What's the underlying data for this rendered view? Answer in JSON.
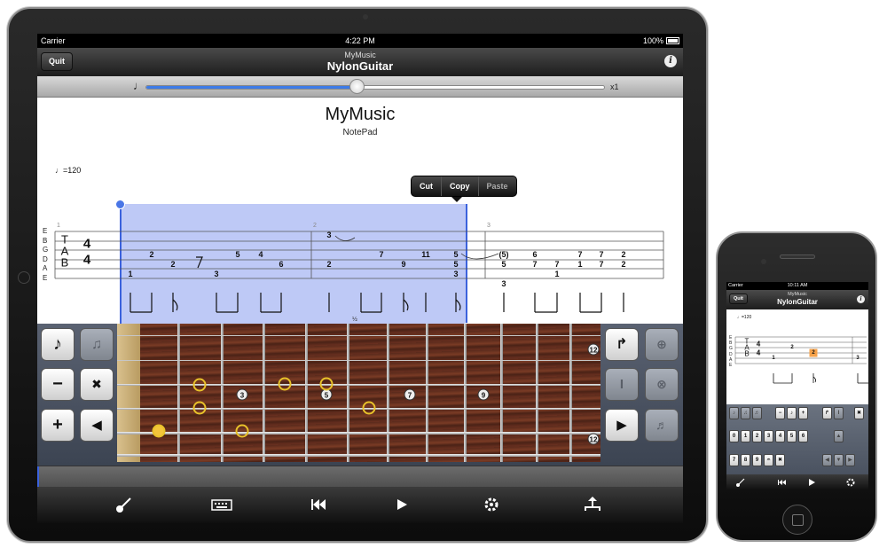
{
  "statusbar": {
    "carrier": "Carrier",
    "time": "4:22 PM",
    "battery": "100%"
  },
  "navbar": {
    "quit": "Quit",
    "subtitle": "MyMusic",
    "title": "NylonGuitar",
    "info": "i"
  },
  "tempo_slider": {
    "note": "♩",
    "multiplier": "x1",
    "value": 0.46
  },
  "score": {
    "title": "MyMusic",
    "subtitle": "NotePad",
    "tempo": "=120",
    "string_names": [
      "E",
      "B",
      "G",
      "D",
      "A",
      "E"
    ],
    "tab_clef": [
      "T",
      "A",
      "B"
    ],
    "time_signature": [
      "4",
      "4"
    ],
    "measure_numbers": [
      "1",
      "2",
      "3"
    ],
    "context_menu": [
      "Cut",
      "Copy",
      "Paste"
    ],
    "measure1": [
      "1",
      "2",
      "2",
      "3",
      "5",
      "4",
      "6"
    ],
    "measure2": [
      "3",
      "2",
      "7",
      "9",
      "11",
      "5",
      "5",
      "3"
    ],
    "measure3": [
      "(5)",
      "5",
      "3",
      "6",
      "7",
      "7",
      "1",
      "7",
      "1",
      "7",
      "7",
      "2",
      "2"
    ]
  },
  "fretboard": {
    "half_marker": "½",
    "markers": [
      "3",
      "5",
      "7",
      "9",
      "12",
      "12"
    ]
  },
  "tools_left": {
    "note": "♪",
    "minus": "−",
    "plus": "+",
    "shuffle": "✖",
    "left": "◀"
  },
  "tools_right": {
    "bend": "↱",
    "right": "▶",
    "bar": "I"
  },
  "tabbar": [
    "guitar-icon",
    "keyboard-icon",
    "rewind-icon",
    "play-icon",
    "settings-icon",
    "share-icon"
  ],
  "iphone": {
    "statusbar": {
      "carrier": "Carrier",
      "time": "10:11 AM"
    },
    "navbar": {
      "quit": "Quit",
      "subtitle": "MyMusic",
      "title": "NylonGuitar",
      "info": "i"
    },
    "tempo": "=120",
    "string_names": [
      "E",
      "B",
      "G",
      "D",
      "A",
      "E"
    ],
    "tab_clef": [
      "T",
      "A",
      "B"
    ],
    "time_signature": [
      "4",
      "4"
    ],
    "frets": [
      "1",
      "2",
      "2",
      "3"
    ],
    "selected_fret": "2",
    "keys_row1": [
      "−",
      "♪",
      "+"
    ],
    "keys_row2": [
      "0",
      "1",
      "2",
      "3",
      "4",
      "5",
      "6"
    ],
    "keys_row3": [
      "7",
      "8",
      "9",
      "𝄐",
      "✖",
      "◀",
      "▶"
    ],
    "up": "▲",
    "down": "▼"
  }
}
